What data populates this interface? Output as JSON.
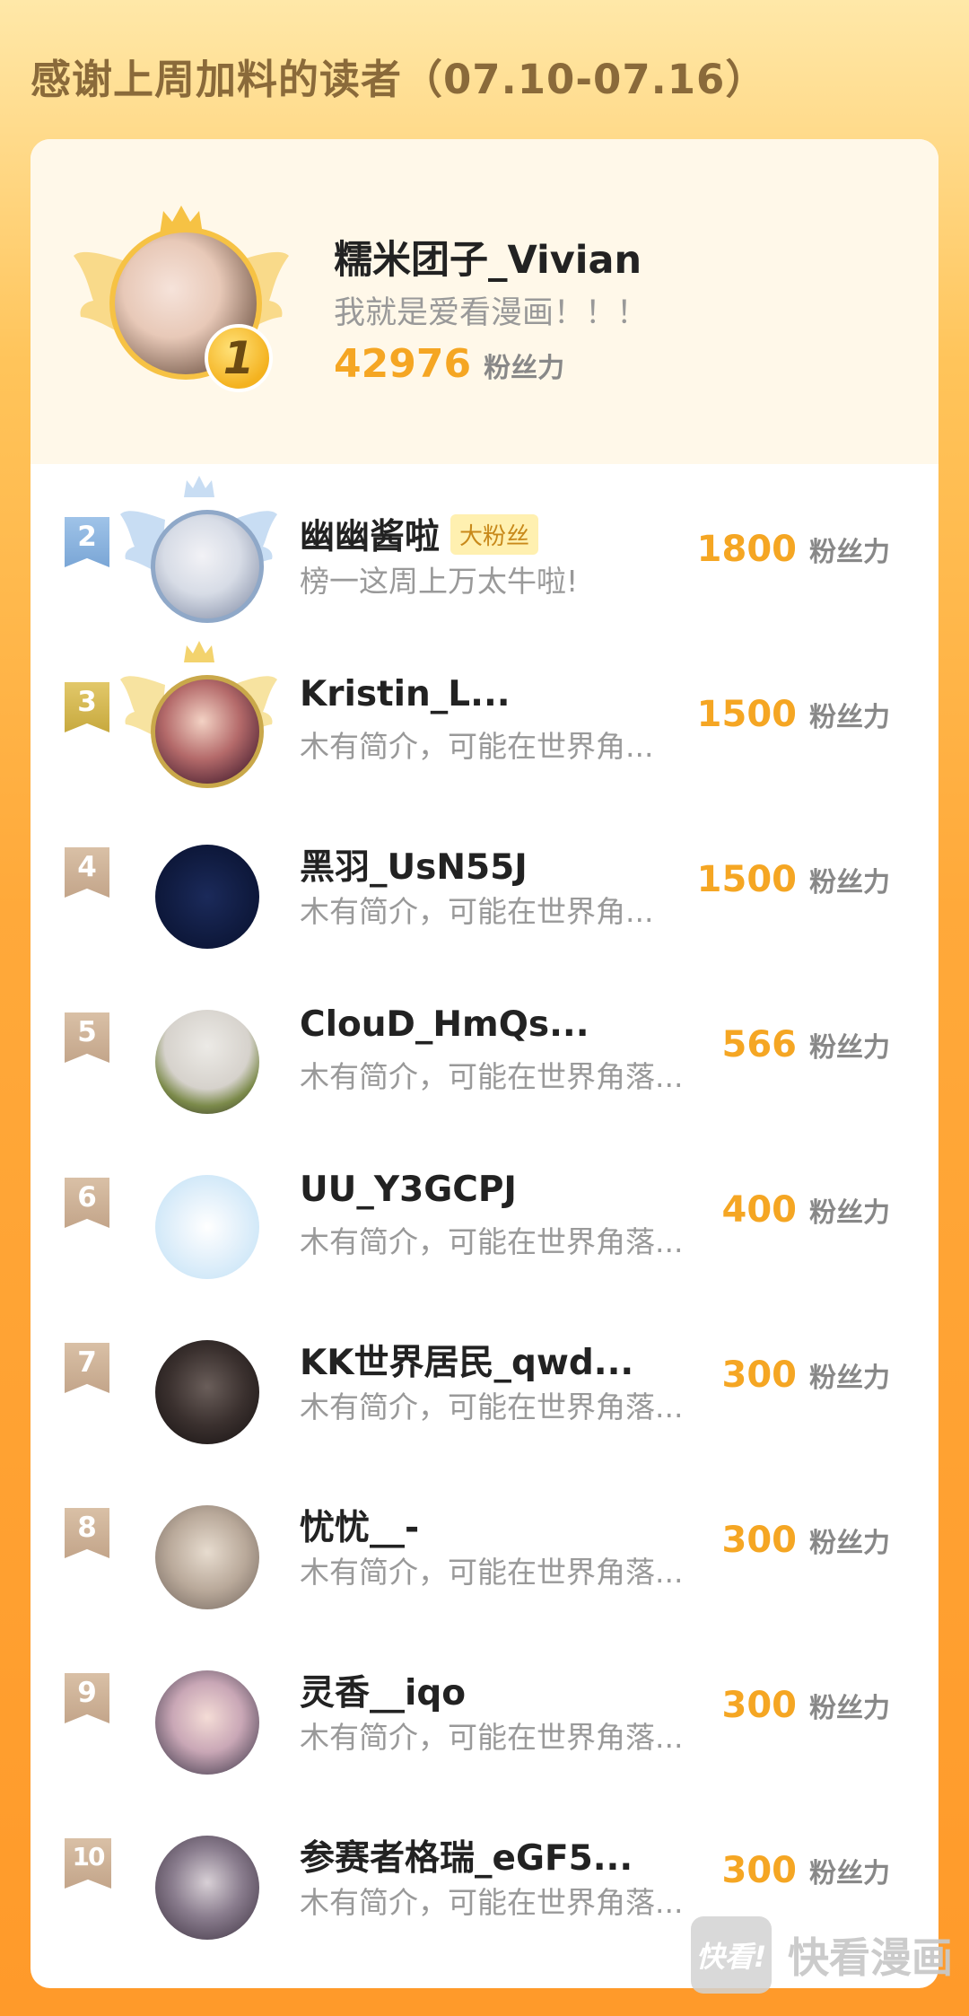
{
  "page": {
    "title": "感谢上周加料的读者（07.10-07.16）"
  },
  "top_user": {
    "rank": "1",
    "name": "糯米团子_Vivian",
    "bio": "我就是爱看漫画！！！",
    "score": "42976",
    "unit": "粉丝力"
  },
  "list": [
    {
      "rank": "2",
      "name": "幽幽酱啦",
      "badge": "大粉丝",
      "bio": "榜一这周上万太牛啦!",
      "score": "1800",
      "unit": "粉丝力"
    },
    {
      "rank": "3",
      "name": "Kristin_L...",
      "bio": "木有简介，可能在世界角...",
      "score": "1500",
      "unit": "粉丝力"
    },
    {
      "rank": "4",
      "name": "黑羽_UsN55J",
      "bio": "木有简介，可能在世界角...",
      "score": "1500",
      "unit": "粉丝力"
    },
    {
      "rank": "5",
      "name": "ClouD_HmQs...",
      "bio": "木有简介，可能在世界角落...",
      "score": "566",
      "unit": "粉丝力"
    },
    {
      "rank": "6",
      "name": "UU_Y3GCPJ",
      "bio": "木有简介，可能在世界角落...",
      "score": "400",
      "unit": "粉丝力"
    },
    {
      "rank": "7",
      "name": "KK世界居民_qwd...",
      "bio": "木有简介，可能在世界角落...",
      "score": "300",
      "unit": "粉丝力"
    },
    {
      "rank": "8",
      "name": "忧忧__-",
      "bio": "木有简介，可能在世界角落...",
      "score": "300",
      "unit": "粉丝力"
    },
    {
      "rank": "9",
      "name": "灵香__iqo",
      "bio": "木有简介，可能在世界角落...",
      "score": "300",
      "unit": "粉丝力"
    },
    {
      "rank": "10",
      "name": "参赛者格瑞_eGF5...",
      "bio": "木有简介，可能在世界角落...",
      "score": "300",
      "unit": "粉丝力"
    }
  ],
  "watermark": {
    "logo": "快看!",
    "text": "快看漫画"
  },
  "colors": {
    "accent": "#F5A623",
    "silver": "#7AA6D6",
    "gold": "#C7A93E",
    "bronze": "#C3A58A"
  }
}
